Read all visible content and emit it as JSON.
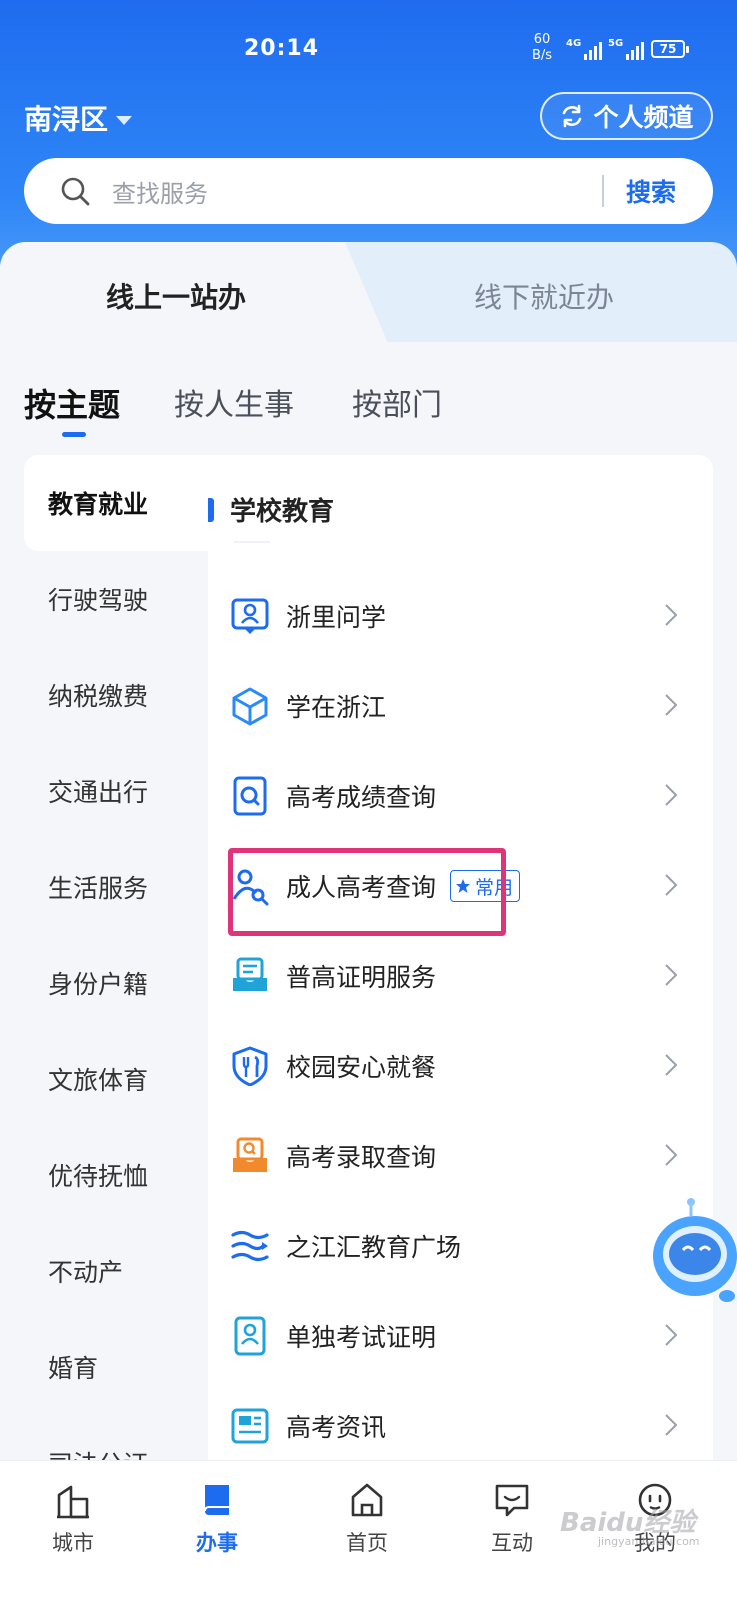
{
  "status_bar": {
    "time": "20:14",
    "net_speed_value": "60",
    "net_speed_unit": "B/s",
    "sim1_label": "4G",
    "sim2_label": "5G",
    "battery": "75"
  },
  "header": {
    "district": "南浔区",
    "channel_button": "个人频道"
  },
  "search": {
    "placeholder": "查找服务",
    "button": "搜索"
  },
  "mode_tabs": [
    {
      "label": "线上一站办",
      "active": true
    },
    {
      "label": "线下就近办",
      "active": false
    }
  ],
  "category_tabs": [
    {
      "label": "按主题",
      "active": true
    },
    {
      "label": "按人生事",
      "active": false
    },
    {
      "label": "按部门",
      "active": false
    }
  ],
  "sidebar": {
    "items": [
      {
        "label": "教育就业",
        "active": true
      },
      {
        "label": "行驶驾驶"
      },
      {
        "label": "纳税缴费"
      },
      {
        "label": "交通出行"
      },
      {
        "label": "生活服务"
      },
      {
        "label": "身份户籍"
      },
      {
        "label": "文旅体育"
      },
      {
        "label": "优待抚恤"
      },
      {
        "label": "不动产"
      },
      {
        "label": "婚育"
      },
      {
        "label": "司法公证"
      }
    ]
  },
  "panel": {
    "section_title": "学校教育",
    "services": [
      {
        "label": "浙里问学",
        "icon": "person-card-icon"
      },
      {
        "label": "学在浙江",
        "icon": "cube-icon"
      },
      {
        "label": "高考成绩查询",
        "icon": "document-search-icon"
      },
      {
        "label": "成人高考查询",
        "icon": "person-search-icon",
        "badge": "常用"
      },
      {
        "label": "普高证明服务",
        "icon": "certificate-tray-icon"
      },
      {
        "label": "校园安心就餐",
        "icon": "shield-cutlery-icon"
      },
      {
        "label": "高考录取查询",
        "icon": "envelope-search-icon"
      },
      {
        "label": "之江汇教育广场",
        "icon": "wave-lines-icon"
      },
      {
        "label": "单独考试证明",
        "icon": "id-card-icon"
      },
      {
        "label": "高考资讯",
        "icon": "news-icon"
      }
    ]
  },
  "bottom_nav": [
    {
      "label": "城市",
      "icon": "city-building-icon"
    },
    {
      "label": "办事",
      "icon": "book-icon",
      "active": true
    },
    {
      "label": "首页",
      "icon": "home-icon"
    },
    {
      "label": "互动",
      "icon": "chat-icon"
    },
    {
      "label": "我的",
      "icon": "profile-face-icon"
    }
  ],
  "watermark": {
    "text": "Baidu经验",
    "sub": "jingyan.baidu.com"
  },
  "colors": {
    "primary": "#1d6cf0",
    "highlight": "#e0347a",
    "orange": "#f08a2c"
  }
}
